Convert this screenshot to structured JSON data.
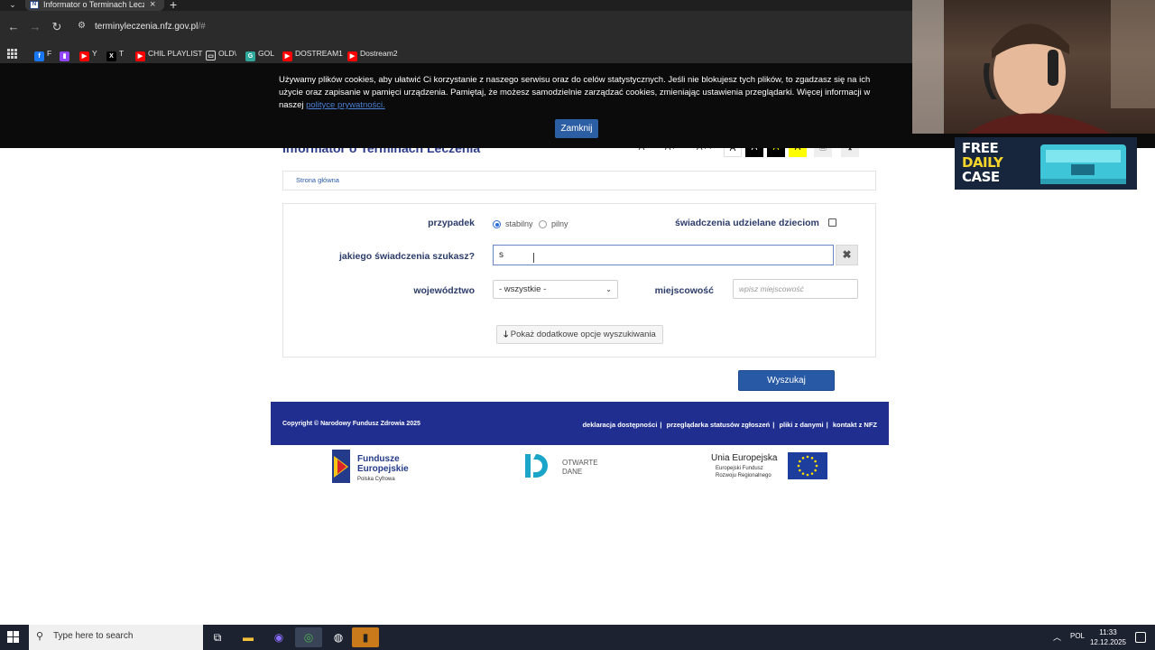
{
  "browser": {
    "tab_title": "Informator o Terminach Leczenia",
    "url_host": "terminyleczenia.nfz.gov.pl",
    "url_rest": "/#",
    "bookmarks": [
      {
        "label": "F",
        "icon": "facebook-icon",
        "color": "#1877f2"
      },
      {
        "label": "",
        "icon": "twitch-icon",
        "color": "#9146ff"
      },
      {
        "label": "Y",
        "icon": "youtube-icon",
        "color": "#ff0000"
      },
      {
        "label": "T",
        "icon": "x-icon",
        "color": "#000000"
      },
      {
        "label": "CHIL PLAYLIST",
        "icon": "youtube-icon",
        "color": "#ff0000"
      },
      {
        "label": "OLD\\",
        "icon": "folder-icon",
        "color": "#2b2b2b"
      },
      {
        "label": "GOL",
        "icon": "gol-icon",
        "color": "#2ea89b"
      },
      {
        "label": "DOSTREAM1",
        "icon": "youtube-icon",
        "color": "#ff0000"
      },
      {
        "label": "Dostream2",
        "icon": "youtube-icon",
        "color": "#ff0000"
      }
    ]
  },
  "cookie": {
    "text": "Używamy plików cookies, aby ułatwić Ci korzystanie z naszego serwisu oraz do celów statystycznych. Jeśli nie blokujesz tych plików, to zgadzasz się na ich użycie oraz zapisanie w pamięci urządzenia. Pamiętaj, że możesz samodzielnie zarządzać cookies, zmieniając ustawienia przeglądarki. Więcej informacji w naszej ",
    "link": "polityce prywatności.",
    "close_label": "Zamknij"
  },
  "site": {
    "title": "Informator o Terminach Leczenia",
    "font_buttons": [
      "A",
      "A+",
      "A++"
    ],
    "contrast_buttons": [
      "A",
      "A",
      "A",
      "A"
    ],
    "breadcrumb_home": "Strona główna"
  },
  "form": {
    "case_label": "przypadek",
    "case_options": [
      {
        "label": "stabilny",
        "selected": true
      },
      {
        "label": "pilny",
        "selected": false
      }
    ],
    "children_label": "świadczenia udzielane dzieciom",
    "children_checked": false,
    "service_label": "jakiego świadczenia szukasz?",
    "service_value": "s",
    "clear_icon": "close-icon",
    "voivodeship_label": "województwo",
    "voivodeship_value": "- wszystkie -",
    "city_label": "miejscowość",
    "city_placeholder": "wpisz miejscowość",
    "more_options_label": "Pokaż dodatkowe opcje wyszukiwania",
    "search_label": "Wyszukaj"
  },
  "footer": {
    "copyright": "Copyright © Narodowy Fundusz Zdrowia 2025",
    "links": [
      "deklaracja dostępności",
      "przeglądarka statusów zgłoszeń",
      "pliki z danymi",
      "kontakt z NFZ"
    ],
    "logos": {
      "fe_title": "Fundusze\nEuropejskie",
      "fe_sub": "Polska Cyfrowa",
      "od_title": "OTWARTE\nDANE",
      "ue_title": "Unia Europejska",
      "ue_sub": "Europejski Fundusz\nRozwoju Regionalnego"
    }
  },
  "overlay": {
    "promo_line1": "FREE",
    "promo_line2": "DAILY",
    "promo_line3": "CASE"
  },
  "taskbar": {
    "search_placeholder": "Type here to search",
    "language": "POL",
    "time": "11:33",
    "date": "12.12.2025"
  },
  "colors": {
    "nfz_navy": "#1f2e8f",
    "button_blue": "#2859a4",
    "cookie_bg": "#0b0b0b"
  }
}
